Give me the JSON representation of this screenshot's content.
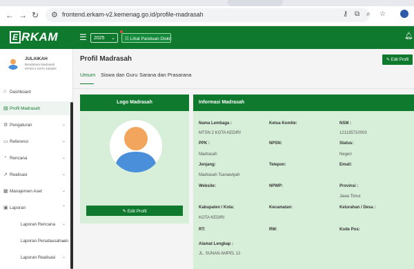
{
  "browser": {
    "url": "frontend.erkam-v2.kemenag.go.id/profile-madrasah",
    "back_icon": "back-arrow-icon",
    "forward_icon": "forward-arrow-icon",
    "reload_icon": "reload-icon"
  },
  "header": {
    "logo_letter": "E",
    "logo_text": "RKAM",
    "year": "2025",
    "guide_label": "Lihat Panduan Diskit"
  },
  "user": {
    "name": "JULAIKAH",
    "role": "Bendahara Madrasah",
    "org": "MTSN 2 KOTA KEDIRI"
  },
  "sidebar": {
    "items": [
      {
        "label": "Dashboard",
        "icon": "home-icon"
      },
      {
        "label": "Profil Madrasah",
        "icon": "profile-icon"
      },
      {
        "label": "Pengaturan",
        "icon": "gear-icon"
      },
      {
        "label": "Referensi",
        "icon": "book-icon"
      },
      {
        "label": "Rencana",
        "icon": "plan-icon"
      },
      {
        "label": "Realisasi",
        "icon": "chart-icon"
      },
      {
        "label": "Manajemen Aset",
        "icon": "asset-icon"
      },
      {
        "label": "Laporan",
        "icon": "report-icon"
      },
      {
        "label": "Laporan Rencana"
      },
      {
        "label": "Laporan Penatausahaan"
      },
      {
        "label": "Laporan Realisasi"
      }
    ]
  },
  "main": {
    "title": "Profil Madrasah",
    "edit_top": "Edit Profil",
    "tabs": [
      "Umum",
      "Siswa dan Guru",
      "Sarana dan Prasarana"
    ],
    "logo_card": {
      "title": "Logo Madrasah",
      "edit_label": "Edit Profil"
    },
    "info_card": {
      "title": "Informasi Madrasah",
      "fields": [
        {
          "label": "Nama Lembaga :",
          "value": "MTSN 2 KOTA KEDIRI"
        },
        {
          "label": "Ketua Komite:",
          "value": ""
        },
        {
          "label": "NSM :",
          "value": "121135710003"
        },
        {
          "label": "PPK :",
          "value": "Madrasah"
        },
        {
          "label": "NPSN:",
          "value": ""
        },
        {
          "label": "Status:",
          "value": "Negeri"
        },
        {
          "label": "Jenjang:",
          "value": "Madrasah Tsanawiyah"
        },
        {
          "label": "Telepon:",
          "value": ""
        },
        {
          "label": "Email:",
          "value": ""
        },
        {
          "label": "Website:",
          "value": ""
        },
        {
          "label": "NPWP:",
          "value": ""
        },
        {
          "label": "Provinsi :",
          "value": "Jawa Timur"
        },
        {
          "label": "Kabupaten / Kota:",
          "value": "KOTA KEDIRI"
        },
        {
          "label": "Kecamatan:",
          "value": ""
        },
        {
          "label": "Kelurahan / Desa :",
          "value": ""
        },
        {
          "label": "RT:",
          "value": ""
        },
        {
          "label": "RW:",
          "value": ""
        },
        {
          "label": "Kode Pos:",
          "value": ""
        },
        {
          "label": "Alamat Lengkap :",
          "value": "JL. SUNAN AMPEL 12"
        }
      ]
    }
  }
}
